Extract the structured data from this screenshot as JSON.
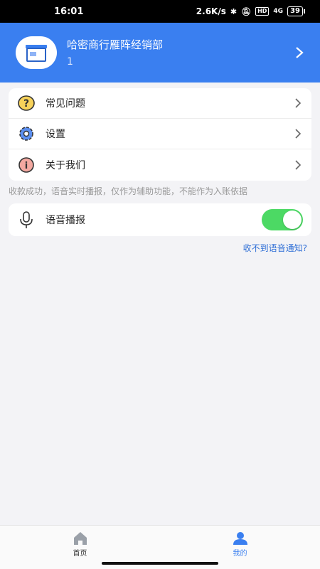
{
  "status_bar": {
    "time": "16:01",
    "net_speed": "2.6K/s",
    "hd": "HD",
    "signal": "4G",
    "battery": "39"
  },
  "header": {
    "store_name": "哈密商行雁阵经销部",
    "store_sub": "1",
    "brand_color": "#3a7ff0"
  },
  "menu": {
    "items": [
      {
        "label": "常见问题",
        "icon": "question-icon"
      },
      {
        "label": "设置",
        "icon": "gear-icon"
      },
      {
        "label": "关于我们",
        "icon": "info-icon"
      }
    ]
  },
  "notice": "收款成功，语音实时播报，仅作为辅助功能，不能作为入账依据",
  "voice": {
    "label": "语音播报",
    "enabled": true,
    "toggle_color": "#4cd964"
  },
  "help_link": "收不到语音通知?",
  "bottom_nav": {
    "items": [
      {
        "label": "首页",
        "icon": "home-icon",
        "active": false
      },
      {
        "label": "我的",
        "icon": "user-icon",
        "active": true
      }
    ]
  }
}
